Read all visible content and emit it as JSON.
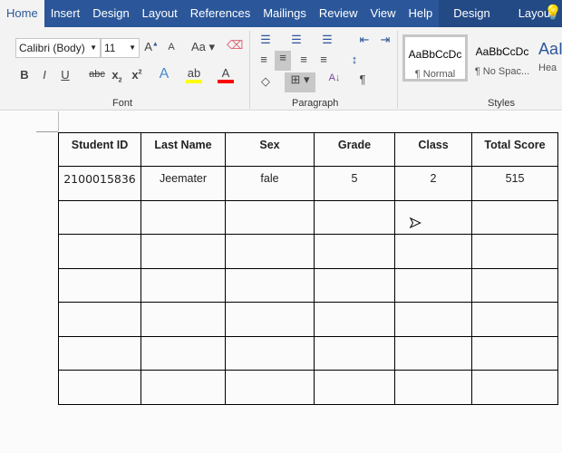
{
  "tabs": [
    "Home",
    "Insert",
    "Design",
    "Layout",
    "References",
    "Mailings",
    "Review",
    "View",
    "Help",
    "Design",
    "Layout"
  ],
  "font": {
    "name": "Calibri (Body)",
    "size": "11",
    "group_label": "Font"
  },
  "paragraph": {
    "group_label": "Paragraph"
  },
  "styles": {
    "group_label": "Styles",
    "items": [
      {
        "sample": "AaBbCcDc",
        "name": "¶ Normal"
      },
      {
        "sample": "AaBbCcDc",
        "name": "¶ No Spac..."
      },
      {
        "sample": "AaI",
        "name": "Hea"
      }
    ]
  },
  "table": {
    "headers": [
      "Student ID",
      "Last Name",
      "Sex",
      "Grade",
      "Class",
      "Total Score"
    ],
    "rows": [
      [
        "2100015836",
        "Jeemater",
        "fale",
        "5",
        "2",
        "515"
      ],
      [
        "",
        "",
        "",
        "",
        "",
        ""
      ],
      [
        "",
        "",
        "",
        "",
        "",
        ""
      ],
      [
        "",
        "",
        "",
        "",
        "",
        ""
      ],
      [
        "",
        "",
        "",
        "",
        "",
        ""
      ],
      [
        "",
        "",
        "",
        "",
        "",
        ""
      ],
      [
        "",
        "",
        "",
        "",
        "",
        ""
      ]
    ]
  }
}
